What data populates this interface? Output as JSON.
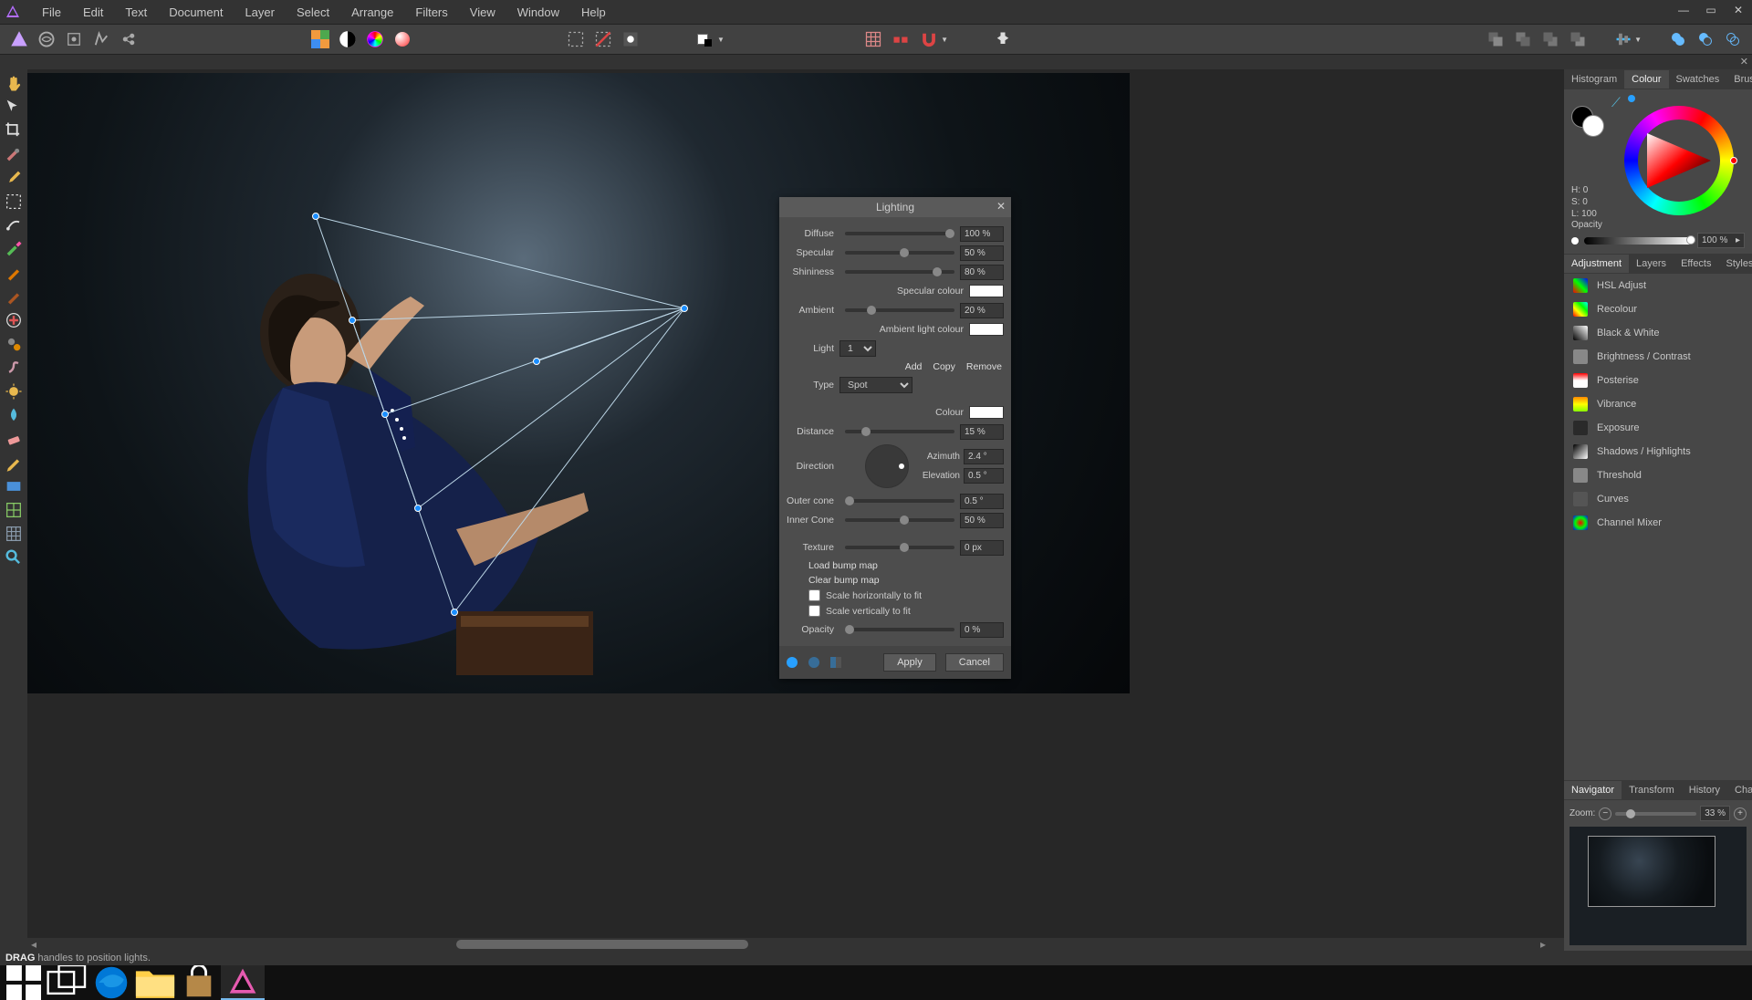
{
  "menubar": [
    "File",
    "Edit",
    "Text",
    "Document",
    "Layer",
    "Select",
    "Arrange",
    "Filters",
    "View",
    "Window",
    "Help"
  ],
  "status": {
    "strong": "DRAG",
    "rest": "handles to position lights."
  },
  "panels": {
    "color_tabs": [
      "Histogram",
      "Colour",
      "Swatches",
      "Brushes"
    ],
    "color_tabs_active": 1,
    "hsl": {
      "h": "H: 0",
      "s": "S: 0",
      "l": "L: 100",
      "opacity_label": "Opacity",
      "opacity_val": "100 %"
    },
    "adj_tabs": [
      "Adjustment",
      "Layers",
      "Effects",
      "Styles"
    ],
    "adj_tabs_active": 0,
    "adjustments": [
      {
        "name": "HSL Adjust",
        "color": "linear-gradient(45deg,#f00,#0f0,#00f)"
      },
      {
        "name": "Recolour",
        "color": "linear-gradient(45deg,#f00,#ff0,#0f0,#0ff)"
      },
      {
        "name": "Black & White",
        "color": "linear-gradient(45deg,#000,#fff)"
      },
      {
        "name": "Brightness / Contrast",
        "color": "#888"
      },
      {
        "name": "Posterise",
        "color": "linear-gradient(#f00,#fff 50%,#fff)"
      },
      {
        "name": "Vibrance",
        "color": "linear-gradient(#f80,#ff0,#8f0)"
      },
      {
        "name": "Exposure",
        "color": "#0006"
      },
      {
        "name": "Shadows / Highlights",
        "color": "linear-gradient(135deg,#000,#fff)"
      },
      {
        "name": "Threshold",
        "color": "#888"
      },
      {
        "name": "Curves",
        "color": "#555"
      },
      {
        "name": "Channel Mixer",
        "color": "radial-gradient(#f00,#0f0,#00f)"
      }
    ],
    "nav_tabs": [
      "Navigator",
      "Transform",
      "History",
      "Channels"
    ],
    "nav_tabs_active": 0,
    "zoom": {
      "label": "Zoom:",
      "value": "33 %"
    }
  },
  "dialog": {
    "title": "Lighting",
    "diffuse": {
      "label": "Diffuse",
      "val": "100 %",
      "pos": 100
    },
    "specular": {
      "label": "Specular",
      "val": "50 %",
      "pos": 50
    },
    "shininess": {
      "label": "Shininess",
      "val": "80 %",
      "pos": 80
    },
    "specular_colour": "Specular colour",
    "ambient": {
      "label": "Ambient",
      "val": "20 %",
      "pos": 20
    },
    "ambient_colour": "Ambient light colour",
    "light_label": "Light",
    "light_val": "1",
    "links": [
      "Add",
      "Copy",
      "Remove"
    ],
    "type_label": "Type",
    "type_val": "Spot",
    "colour_label": "Colour",
    "distance": {
      "label": "Distance",
      "val": "15 %",
      "pos": 15
    },
    "direction_label": "Direction",
    "azimuth": {
      "label": "Azimuth",
      "val": "2.4 °"
    },
    "elevation": {
      "label": "Elevation",
      "val": "0.5 °"
    },
    "outer": {
      "label": "Outer cone",
      "val": "0.5 °",
      "pos": 0
    },
    "inner": {
      "label": "Inner Cone",
      "val": "50 %",
      "pos": 50
    },
    "texture": {
      "label": "Texture",
      "val": "0 px",
      "pos": 50
    },
    "load_bump": "Load bump map",
    "clear_bump": "Clear bump map",
    "scale_h": "Scale horizontally to fit",
    "scale_v": "Scale vertically to fit",
    "opacity": {
      "label": "Opacity",
      "val": "0 %",
      "pos": 0
    },
    "apply": "Apply",
    "cancel": "Cancel"
  },
  "tools": [
    "hand",
    "move",
    "crop",
    "brush",
    "dropper",
    "marquee",
    "freehand",
    "paint",
    "pen1",
    "pen2",
    "heal",
    "clone",
    "smudge",
    "dodge",
    "blur",
    "eraser",
    "pencil",
    "rect",
    "mesh",
    "grid",
    "zoom"
  ]
}
